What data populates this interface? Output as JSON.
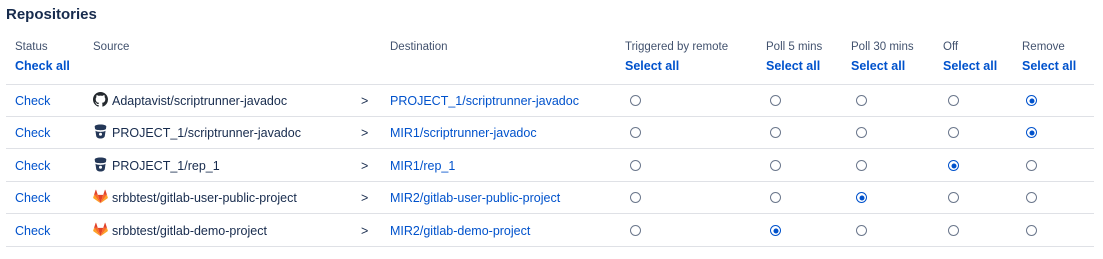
{
  "title": "Repositories",
  "headers": {
    "status": "Status",
    "status_action": "Check all",
    "source": "Source",
    "destination": "Destination",
    "triggered": "Triggered by remote",
    "triggered_action": "Select all",
    "poll5": "Poll 5 mins",
    "poll5_action": "Select all",
    "poll30": "Poll 30 mins",
    "poll30_action": "Select all",
    "off": "Off",
    "off_action": "Select all",
    "remove": "Remove",
    "remove_action": "Select all"
  },
  "rows": [
    {
      "check": "Check",
      "icon": "github-icon",
      "source": "Adaptavist/scriptrunner-javadoc",
      "arrow": ">",
      "destination": "PROJECT_1/scriptrunner-javadoc",
      "selected": "remove"
    },
    {
      "check": "Check",
      "icon": "bitbucket-server-icon",
      "source": "PROJECT_1/scriptrunner-javadoc",
      "arrow": ">",
      "destination": "MIR1/scriptrunner-javadoc",
      "selected": "remove"
    },
    {
      "check": "Check",
      "icon": "bitbucket-server-icon",
      "source": "PROJECT_1/rep_1",
      "arrow": ">",
      "destination": "MIR1/rep_1",
      "selected": "off"
    },
    {
      "check": "Check",
      "icon": "gitlab-icon",
      "source": "srbbtest/gitlab-user-public-project",
      "arrow": ">",
      "destination": "MIR2/gitlab-user-public-project",
      "selected": "poll30"
    },
    {
      "check": "Check",
      "icon": "gitlab-icon",
      "source": "srbbtest/gitlab-demo-project",
      "arrow": ">",
      "destination": "MIR2/gitlab-demo-project",
      "selected": "poll5"
    }
  ],
  "colors": {
    "link": "#0052cc",
    "text": "#172b4d",
    "border": "#dfe1e6"
  }
}
